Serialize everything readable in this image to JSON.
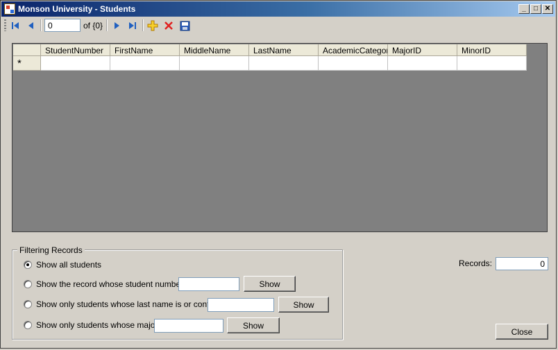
{
  "window": {
    "title": "Monson University - Students",
    "controls": {
      "minimize": "_",
      "maximize": "□",
      "close": "✕"
    }
  },
  "toolbar": {
    "position_value": "0",
    "count_label": "of {0}",
    "icons": [
      "move-first-icon",
      "move-previous-icon",
      "move-next-icon",
      "move-last-icon",
      "add-new-icon",
      "delete-icon",
      "save-icon"
    ]
  },
  "grid": {
    "columns": [
      "StudentNumber",
      "FirstName",
      "MiddleName",
      "LastName",
      "AcademicCategory",
      "MajorID",
      "MinorID"
    ],
    "new_row_marker": "*"
  },
  "filter": {
    "legend": "Filtering Records",
    "options": [
      {
        "label": "Show all students",
        "checked": true
      },
      {
        "label": "Show the record whose student number is",
        "button": "Show"
      },
      {
        "label": "Show only students whose last name is or contains",
        "button": "Show"
      },
      {
        "label": "Show only students whose major is",
        "button": "Show"
      }
    ]
  },
  "records": {
    "label": "Records:",
    "value": "0"
  },
  "close_button": "Close",
  "colors": {
    "titlebar_start": "#0a246a",
    "titlebar_end": "#a6caf0",
    "window_bg": "#d4d0c8",
    "grid_bg": "#808080"
  }
}
